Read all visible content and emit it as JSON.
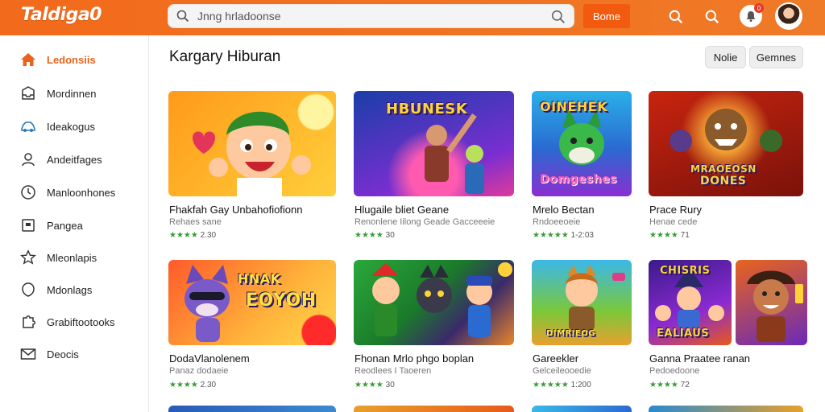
{
  "app": {
    "logo": "Taldiga0"
  },
  "search": {
    "value": "Jnng hrladoonse"
  },
  "header": {
    "bonus_label": "Bome",
    "notif_count": "0"
  },
  "sidebar": {
    "items": [
      {
        "label": "Ledonsiis",
        "icon": "home-icon"
      },
      {
        "label": "Mordinnen",
        "icon": "inbox-icon"
      },
      {
        "label": "Ideakogus",
        "icon": "car-icon"
      },
      {
        "label": "Andeitfages",
        "icon": "user-icon"
      },
      {
        "label": "Manloonhones",
        "icon": "clock-icon"
      },
      {
        "label": "Pangea",
        "icon": "square-icon"
      },
      {
        "label": "Mleonlapis",
        "icon": "star-icon"
      },
      {
        "label": "Mdonlags",
        "icon": "shield-icon"
      },
      {
        "label": "Grabiftootooks",
        "icon": "puzzle-icon"
      },
      {
        "label": "Deocis",
        "icon": "mail-icon"
      }
    ]
  },
  "main": {
    "title": "Kargary Hiburan",
    "filters": [
      "Nolie",
      "Gemnes"
    ],
    "cards": [
      {
        "title": "Fhakfah Gay Unbahofiofionn",
        "sub": "Rehaes sane",
        "stars": "★★★★",
        "rating": "2.30",
        "art": "",
        "colors": [
          "#ffb21e",
          "#ff8a1a"
        ]
      },
      {
        "title": "Hlugaile bliet Geane",
        "sub": "Renonlene Iilong Geade Gacceeeie",
        "stars": "★★★★",
        "rating": "30",
        "art": "HBUNESK",
        "colors": [
          "#2a52c9",
          "#6a34b8"
        ]
      },
      {
        "title": "Mrelo Bectan",
        "sub": "Rndoeeoeie",
        "stars": "★★★★★",
        "rating": "1-2:03",
        "art": "Domgeshes",
        "colors": [
          "#31b8e8",
          "#7a3fd1"
        ]
      },
      {
        "title": "Prace Rury",
        "sub": "Henae cede",
        "stars": "★★★★",
        "rating": "71",
        "art": "DONES",
        "colors": [
          "#ff5a1a",
          "#b8220f"
        ]
      },
      {
        "title": "DodaVlanolenem",
        "sub": "Panaz dodaeie",
        "stars": "★★★★",
        "rating": "2.30",
        "art": "EOYOH",
        "colors": [
          "#ff6a2a",
          "#ffb638"
        ]
      },
      {
        "title": "Fhonan Mrlo phgo boplan",
        "sub": "Reodlees I Taoeren",
        "stars": "★★★★",
        "rating": "30",
        "art": "",
        "colors": [
          "#2a9e3a",
          "#e94a2a"
        ]
      },
      {
        "title": "Gareekler",
        "sub": "Gelceileooedie",
        "stars": "★★★★★",
        "rating": "1:200",
        "art": "DIMRIEOG",
        "colors": [
          "#3ab8e0",
          "#e8a030"
        ]
      },
      {
        "title": "Ganna Praatee ranan",
        "sub": "Pedoedoone",
        "stars": "★★★★",
        "rating": "72",
        "art": "EALIAUS",
        "colors": [
          "#6a2ad1",
          "#e85a1a"
        ]
      }
    ]
  },
  "colors": {
    "brand": "#f26a1b",
    "accent": "#e8641d",
    "stars": "#3a9a3a"
  }
}
